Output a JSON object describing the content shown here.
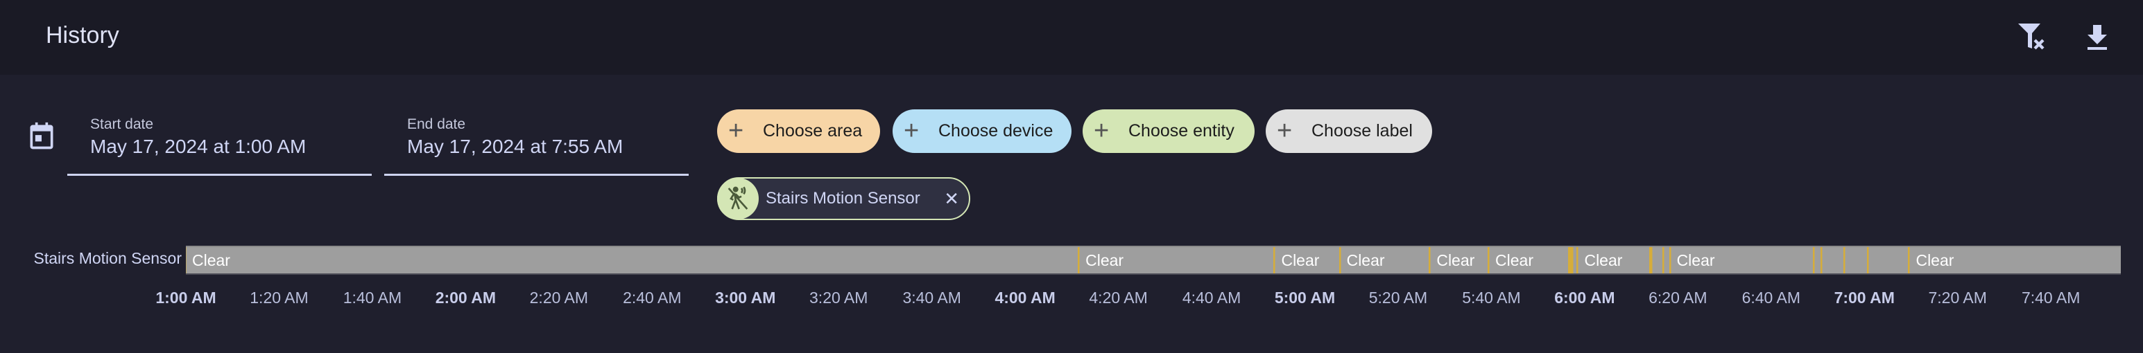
{
  "header": {
    "title": "History",
    "icons": [
      "filter-remove-icon",
      "download-icon"
    ]
  },
  "dates": {
    "start_label": "Start date",
    "start_value": "May 17, 2024 at 1:00 AM",
    "end_label": "End date",
    "end_value": "May 17, 2024 at 7:55 AM"
  },
  "chips": [
    {
      "label": "Choose area",
      "color": "#f7d5a6"
    },
    {
      "label": "Choose device",
      "color": "#b5dff5"
    },
    {
      "label": "Choose entity",
      "color": "#d4e6b5"
    },
    {
      "label": "Choose label",
      "color": "#e0e0e0"
    }
  ],
  "selected_entity": {
    "label": "Stairs Motion Sensor",
    "icon": "motion-sensor-icon",
    "color": "#d4e6b5"
  },
  "timeline": {
    "entity": "Stairs Motion Sensor",
    "range_start": "01:00:00",
    "range_end": "07:55:00",
    "base_state": "Clear",
    "colors": {
      "Clear": "#9e9e9e",
      "Detected": "#d6ad3a"
    },
    "detected": [
      [
        "04:11:18",
        "04:11:36"
      ],
      [
        "04:53:18",
        "04:53:36"
      ],
      [
        "05:07:18",
        "05:07:36"
      ],
      [
        "05:26:36",
        "05:26:54"
      ],
      [
        "05:39:12",
        "05:39:30"
      ],
      [
        "05:56:30",
        "05:57:30"
      ],
      [
        "05:58:18",
        "05:58:36"
      ],
      [
        "06:13:54",
        "06:14:24"
      ],
      [
        "06:16:42",
        "06:17:00"
      ],
      [
        "06:18:06",
        "06:18:24"
      ],
      [
        "06:48:54",
        "06:49:18"
      ],
      [
        "06:50:36",
        "06:50:54"
      ],
      [
        "06:55:30",
        "06:55:48"
      ],
      [
        "07:00:30",
        "07:00:48"
      ],
      [
        "07:09:24",
        "07:09:42"
      ]
    ],
    "ticks": [
      {
        "label": "1:00 AM",
        "bold": true
      },
      {
        "label": "1:20 AM"
      },
      {
        "label": "1:40 AM"
      },
      {
        "label": "2:00 AM",
        "bold": true
      },
      {
        "label": "2:20 AM"
      },
      {
        "label": "2:40 AM"
      },
      {
        "label": "3:00 AM",
        "bold": true
      },
      {
        "label": "3:20 AM"
      },
      {
        "label": "3:40 AM"
      },
      {
        "label": "4:00 AM",
        "bold": true
      },
      {
        "label": "4:20 AM"
      },
      {
        "label": "4:40 AM"
      },
      {
        "label": "5:00 AM",
        "bold": true
      },
      {
        "label": "5:20 AM"
      },
      {
        "label": "5:40 AM"
      },
      {
        "label": "6:00 AM",
        "bold": true
      },
      {
        "label": "6:20 AM"
      },
      {
        "label": "6:40 AM"
      },
      {
        "label": "7:00 AM",
        "bold": true
      },
      {
        "label": "7:20 AM"
      },
      {
        "label": "7:40 AM"
      }
    ]
  }
}
